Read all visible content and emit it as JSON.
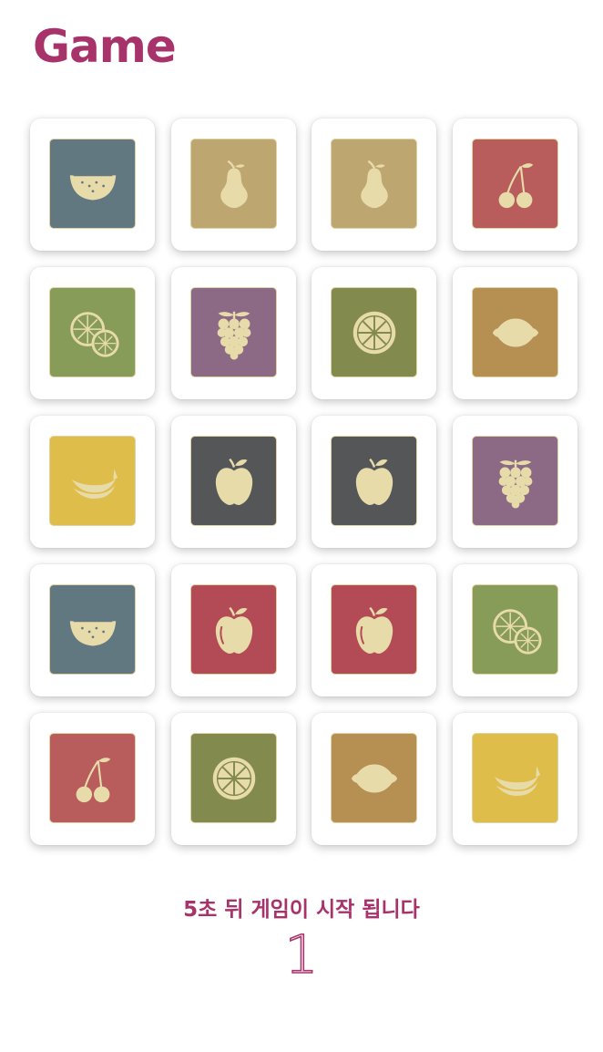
{
  "header": {
    "title": "Game"
  },
  "colors": {
    "brand": "#a8336b",
    "fruit_fill": "#e8dbaa",
    "tile_border": "#e0d2a3"
  },
  "board": {
    "rows": 5,
    "cols": 4,
    "cards": [
      {
        "fruit": "watermelon-icon",
        "color": "#627881"
      },
      {
        "fruit": "pear-icon",
        "color": "#bda670"
      },
      {
        "fruit": "pear-icon",
        "color": "#bda670"
      },
      {
        "fruit": "cherry-icon",
        "color": "#b85c5c"
      },
      {
        "fruit": "orange-slices-icon",
        "color": "#879c59"
      },
      {
        "fruit": "grapes-icon",
        "color": "#8c6a86"
      },
      {
        "fruit": "orange-slice-icon",
        "color": "#828a4e"
      },
      {
        "fruit": "lemon-icon",
        "color": "#b68f52"
      },
      {
        "fruit": "banana-icon",
        "color": "#dfbd4a"
      },
      {
        "fruit": "apple-icon",
        "color": "#545658"
      },
      {
        "fruit": "apple-icon",
        "color": "#545658"
      },
      {
        "fruit": "grapes-icon",
        "color": "#8c6a86"
      },
      {
        "fruit": "watermelon-icon",
        "color": "#627881"
      },
      {
        "fruit": "red-apple-icon",
        "color": "#b34b57"
      },
      {
        "fruit": "red-apple-icon",
        "color": "#b34b57"
      },
      {
        "fruit": "orange-slices-icon",
        "color": "#879c59"
      },
      {
        "fruit": "cherry-icon",
        "color": "#b85c5c"
      },
      {
        "fruit": "orange-slice-icon",
        "color": "#828a4e"
      },
      {
        "fruit": "lemon-icon",
        "color": "#b68f52"
      },
      {
        "fruit": "banana-icon",
        "color": "#dfbd4a"
      }
    ]
  },
  "status": {
    "message": "5초 뒤 게임이 시작 됩니다",
    "countdown": "1"
  }
}
